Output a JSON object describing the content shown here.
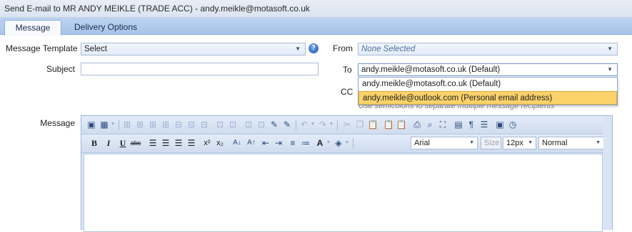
{
  "window": {
    "title": "Send E-mail to MR ANDY MEIKLE (TRADE ACC) - andy.meikle@motasoft.co.uk"
  },
  "tabs": [
    {
      "label": "Message",
      "active": true
    },
    {
      "label": "Delivery Options",
      "active": false
    }
  ],
  "form": {
    "template_label": "Message Template",
    "template_value": "Select",
    "help_icon": "?",
    "from_label": "From",
    "from_value": "None Selected",
    "subject_label": "Subject",
    "subject_value": "",
    "to_label": "To",
    "to_value": "andy.meikle@motasoft.co.uk (Default)",
    "to_options": [
      "andy.meikle@motasoft.co.uk (Default)",
      "andy.meikle@outlook.com (Personal email address)"
    ],
    "to_highlighted_index": 1,
    "cc_label": "CC",
    "cc_hint": "Use semicolons to separate multiple message recipients",
    "message_label": "Message"
  },
  "editor": {
    "font_name": "Arial",
    "size_label": "Size",
    "font_size": "12px",
    "paragraph_style": "Normal",
    "toolbar_row1_icons": [
      "insert-image-icon",
      "insert-table-icon",
      "table-insert-row-above-icon",
      "table-insert-row-below-icon",
      "table-insert-col-left-icon",
      "table-insert-col-right-icon",
      "table-delete-row-icon",
      "table-delete-col-icon",
      "table-delete-icon",
      "table-merge-icon",
      "table-split-icon",
      "cell-properties-icon",
      "table-properties-icon",
      "edit-icon",
      "edit-alt-icon",
      "undo-icon",
      "redo-icon",
      "cut-icon",
      "copy-icon",
      "paste-icon",
      "paste-text-icon",
      "paste-word-icon",
      "print-icon",
      "find-icon",
      "select-all-icon",
      "page-icon",
      "paragraph-marks-icon",
      "align-icon",
      "form-icon",
      "clock-icon"
    ],
    "toolbar_row2_icons": [
      "bold-icon",
      "italic-icon",
      "underline-icon",
      "strikethrough-icon",
      "align-left-icon",
      "align-center-icon",
      "align-right-icon",
      "justify-icon",
      "superscript-icon",
      "subscript-icon",
      "text-case-up-icon",
      "text-case-down-icon",
      "outdent-icon",
      "indent-icon",
      "numbered-list-icon",
      "bullet-list-icon",
      "font-color-icon",
      "highlight-color-icon"
    ],
    "colors": {
      "accent": "#bcd3f0",
      "selection": "#fcd36b",
      "border": "#a9bcd9"
    }
  }
}
